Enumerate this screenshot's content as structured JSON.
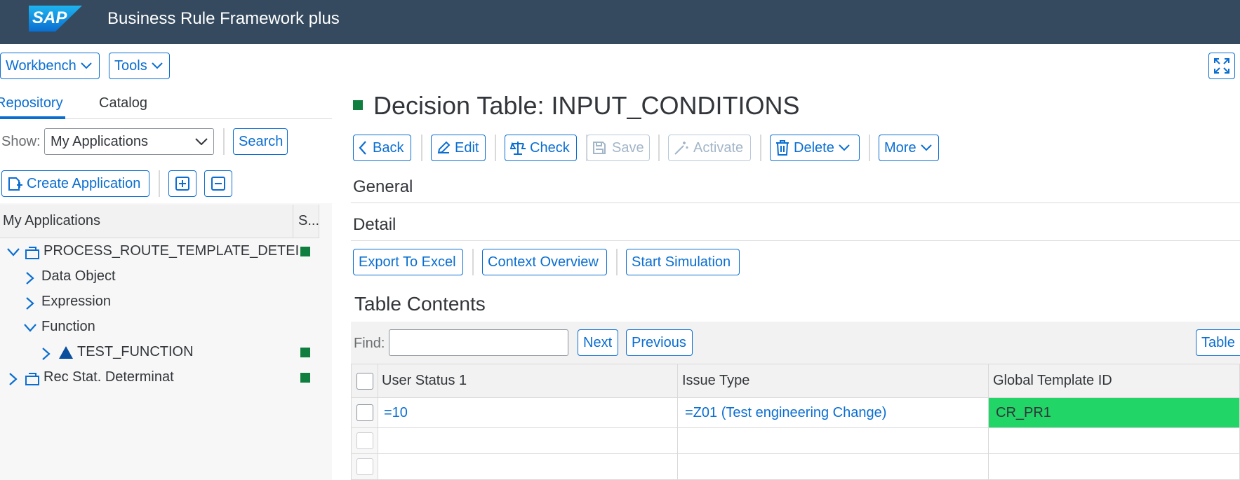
{
  "shell": {
    "logo_text": "SAP",
    "title": "Business Rule Framework plus"
  },
  "toolbar": {
    "workbench_label": "Workbench",
    "tools_label": "Tools"
  },
  "tabs": [
    {
      "label": "Repository"
    },
    {
      "label": "Catalog"
    }
  ],
  "show_filter": {
    "label": "Show:",
    "value": "My Applications",
    "search_label": "Search"
  },
  "create_application_label": "Create Application",
  "tree": {
    "header_name": "My Applications",
    "header_status": "S...",
    "items": [
      {
        "label": "PROCESS_ROUTE_TEMPLATE_DETEI"
      },
      {
        "label": "Data Object"
      },
      {
        "label": "Expression"
      },
      {
        "label": "Function"
      },
      {
        "label": "TEST_FUNCTION"
      },
      {
        "label": "Rec Stat. Determinat"
      }
    ]
  },
  "page": {
    "title": "Decision Table: INPUT_CONDITIONS"
  },
  "actions": {
    "back": "Back",
    "edit": "Edit",
    "check": "Check",
    "save": "Save",
    "activate": "Activate",
    "delete": "Delete",
    "more": "More"
  },
  "sections": {
    "general": "General",
    "detail": "Detail",
    "table_contents": "Table Contents"
  },
  "detail_actions": {
    "export": "Export To Excel",
    "context": "Context Overview",
    "simulation": "Start Simulation"
  },
  "find": {
    "label": "Find:",
    "value": "",
    "next": "Next",
    "previous": "Previous",
    "table_settings": "Table"
  },
  "table": {
    "columns": [
      "User Status 1",
      "Issue Type",
      "Global Template ID"
    ],
    "rows": [
      [
        "=10",
        "=Z01 (Test engineering Change)",
        "CR_PR1"
      ]
    ]
  },
  "colors": {
    "shell": "#354a5f",
    "accent": "#0a6ed1",
    "status_ok": "#107e3e",
    "highlight": "#22d567"
  }
}
